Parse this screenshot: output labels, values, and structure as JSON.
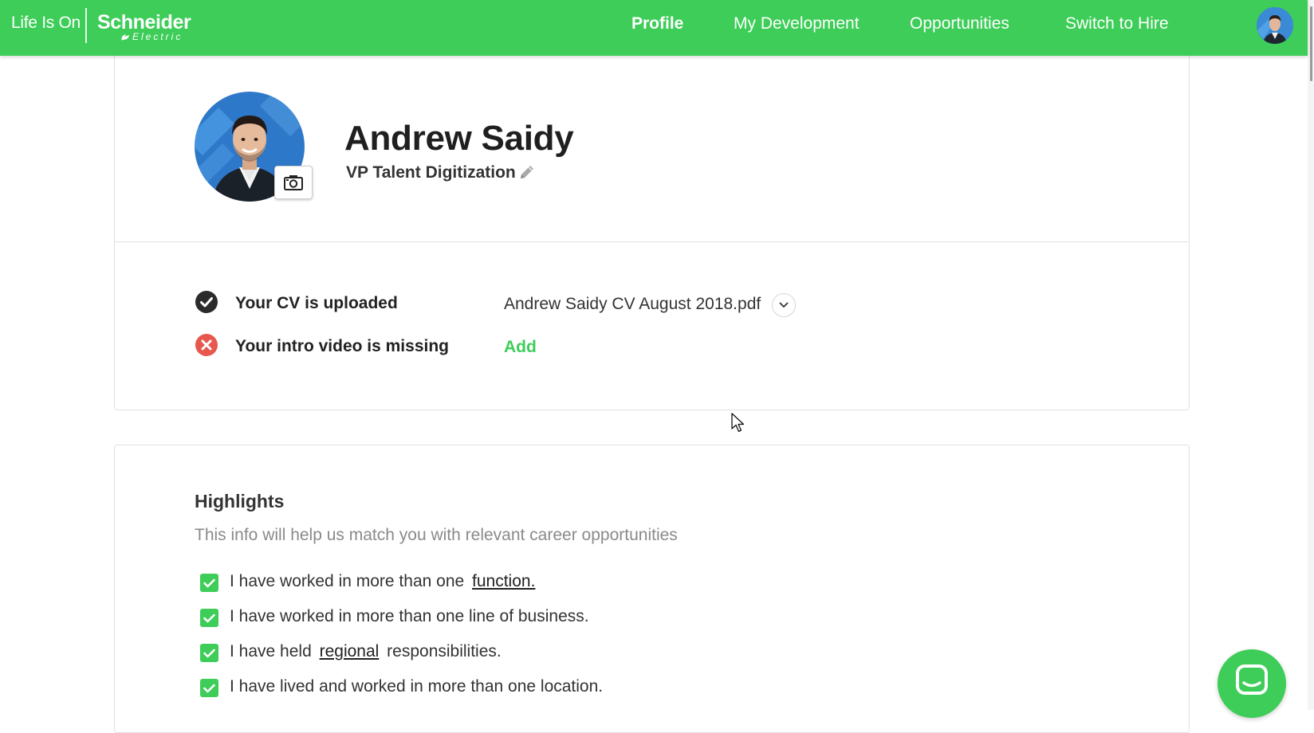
{
  "header": {
    "tagline": "Life Is On",
    "brand_name": "Schneider",
    "brand_sub": "Electric",
    "brand_color": "#3dcd58",
    "nav": [
      {
        "label": "Profile",
        "active": true
      },
      {
        "label": "My Development",
        "active": false
      },
      {
        "label": "Opportunities",
        "active": false
      },
      {
        "label": "Switch to Hire",
        "active": false
      }
    ],
    "user_avatar_icon": "user-avatar-icon"
  },
  "profile": {
    "name": "Andrew Saidy",
    "role": "VP Talent Digitization",
    "photo_action_icon": "camera-icon",
    "edit_icon": "pencil-icon"
  },
  "documents": {
    "cv_status": "Your CV is uploaded",
    "cv_filename": "Andrew Saidy CV August 2018.pdf",
    "cv_status_icon": "check-circle-icon",
    "video_status": "Your intro video is missing",
    "video_status_icon": "error-circle-icon",
    "video_action": "Add"
  },
  "highlights": {
    "title": "Highlights",
    "subtitle": "This info will help us match you with relevant career opportunities",
    "items": [
      {
        "before": "I have worked in more than one",
        "link": "function.",
        "after": "",
        "checked": true
      },
      {
        "before": "I have worked in more than one line of business.",
        "link": "",
        "after": "",
        "checked": true
      },
      {
        "before": "I have held",
        "link": "regional",
        "after": "responsibilities.",
        "checked": true
      },
      {
        "before": "I have lived and worked in more than one location.",
        "link": "",
        "after": "",
        "checked": true
      }
    ]
  },
  "chat": {
    "icon": "chat-icon"
  }
}
